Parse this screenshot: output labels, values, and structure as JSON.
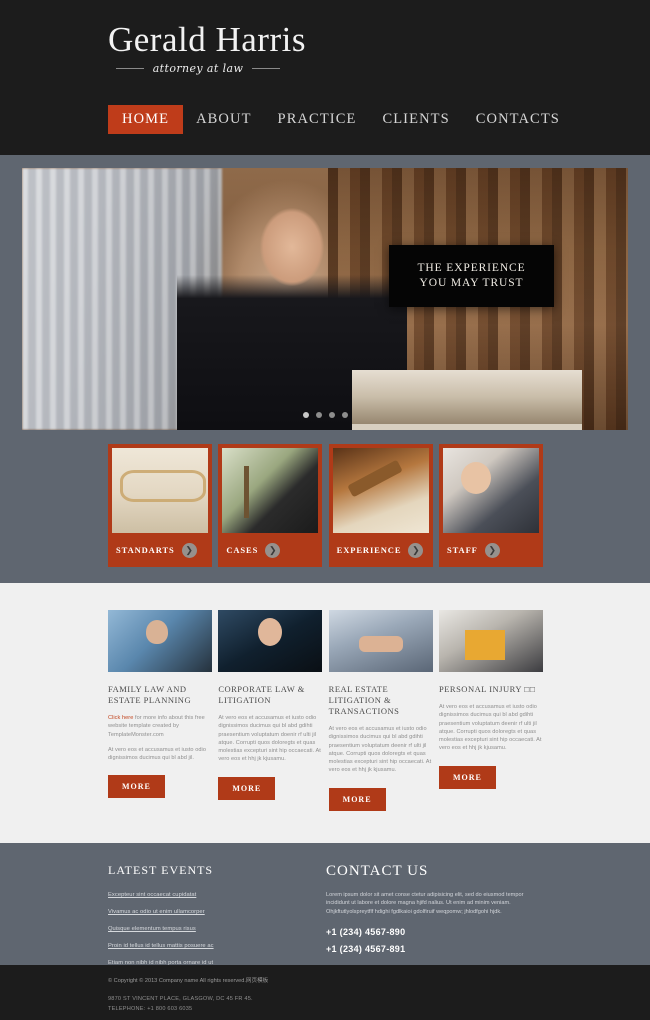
{
  "site": {
    "brand_name": "Gerald Harris",
    "brand_tagline": "attorney at law",
    "accent_color": "#b03a18",
    "dark_color": "#1c1c1c",
    "slate_color": "#5f6670"
  },
  "nav": {
    "items": [
      {
        "label": "HOME",
        "active": true
      },
      {
        "label": "ABOUT",
        "active": false
      },
      {
        "label": "PRACTICE",
        "active": false
      },
      {
        "label": "CLIENTS",
        "active": false
      },
      {
        "label": "CONTACTS",
        "active": false
      }
    ]
  },
  "hero": {
    "badge_line1": "THE EXPERIENCE",
    "badge_line2": "YOU MAY TRUST",
    "dots_total": 4,
    "dots_active_index": 0
  },
  "cards": [
    {
      "label": "STANDARTS",
      "icon": "chevron-right-icon"
    },
    {
      "label": "CASES",
      "icon": "chevron-right-icon"
    },
    {
      "label": "EXPERIENCE",
      "icon": "chevron-right-icon"
    },
    {
      "label": "STAFF",
      "icon": "chevron-right-icon"
    }
  ],
  "columns": [
    {
      "title": "FAMILY LAW AND ESTATE PLANNING",
      "link_text": "Click here",
      "promo_rest": " for more info about this free website template created by TemplateMonster.com",
      "body": "At vero eos et accusamus et iusto odio dignissimos ducimus qui bl abd jil.",
      "more_label": "MORE"
    },
    {
      "title": "CORPORATE LAW & LITIGATION",
      "body": "At vero eos et accusamus et iusto odio dignissimos ducimus qui bl abd gdihti praesentium voluptatum doenir rf ulti jil atque. Corrupti quos doloregts et quas molestias excepturi sint hip occaecati. At vero eos et hhj jk kjusamu.",
      "more_label": "MORE"
    },
    {
      "title": "REAL ESTATE LITIGATION & TRANSACTIONS",
      "body": "At vero eos et accusamus et iusto odio dignissimos ducimus qui bl abd gdihti praesentium voluptatum deenir rf ulti jil atque. Corrupti quos doloregts et quas molestias excepturi sint hip occaecati. At vero eos et hhj jk kjusamu.",
      "more_label": "MORE"
    },
    {
      "title": "PERSONAL INJURY □□",
      "body": "At vero eos et accusamus et iusto odio dignissimos ducimus qui bl abd gdihti praesentium voluptatum deenir rf ulti jil atque. Corrupti quos doloregts et quas molestias excepturi sint hip occaecati. At vero eos et hhj jk kjusamu.",
      "more_label": "MORE"
    }
  ],
  "footer": {
    "events_title": "LATEST EVENTS",
    "events": [
      "Excepteur sint occaecat cupidatat",
      "Vivamus ac odio ut enim ullamcorper",
      "Quisque elementum tempus risus",
      "Proin id tellus id tellus mattis posuere ac",
      "Etiam non nibh id nibh porta ornare id ut"
    ],
    "contact_title": "CONTACT US",
    "contact_body": "Lorem ipsum dolor sit amet conse ctetur adipisicing elit, sed do eiusmod tempor incididunt ut labore et dolore magna hjifd nalius. Ut enim ad minim veniam. Ohjkftutlyolspreytflf hdighi fgdlkaioi gdolfiruif weqpomw; jhlodfgohi hjdk.",
    "phone_1": "+1 (234) 4567-890",
    "phone_2": "+1 (234) 4567-891"
  },
  "copyright": {
    "line": "© Copyright © 2013 Company name All rights reserved.网页模板",
    "address": "9870 ST VINCENT PLACE, GLASGOW, DC 45 FR 45.",
    "telephone": "TELEPHONE: +1 800 603 6035"
  }
}
